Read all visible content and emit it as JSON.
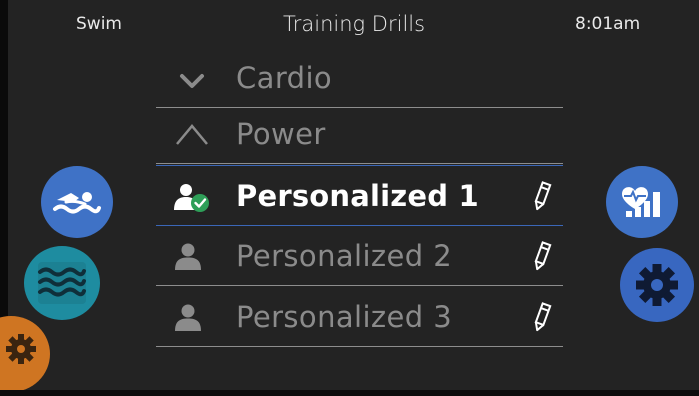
{
  "header": {
    "mode": "Swim",
    "title": "Training Drills",
    "time": "8:01am"
  },
  "list": {
    "items": [
      {
        "label": "Cardio",
        "icon": "chevron-down-icon",
        "editable": false,
        "selected": false
      },
      {
        "label": "Power",
        "icon": "power-chevron-icon",
        "editable": false,
        "selected": false
      },
      {
        "label": "Personalized 1",
        "icon": "user-check-icon",
        "editable": true,
        "selected": true
      },
      {
        "label": "Personalized 2",
        "icon": "user-icon",
        "editable": true,
        "selected": false
      },
      {
        "label": "Personalized 3",
        "icon": "user-icon",
        "editable": true,
        "selected": false
      }
    ]
  },
  "side_buttons": {
    "left": [
      "swim-icon",
      "waves-icon",
      "gear-icon"
    ],
    "right": [
      "heart-chart-icon",
      "gear-icon"
    ]
  },
  "colors": {
    "background": "#232323",
    "selected_text": "#ffffff",
    "unselected_text": "#8b8b8b",
    "selection_line": "#3b67b8",
    "blue_button": "#3f72c6",
    "teal_button": "#1e8ca0",
    "orange_button": "#cf7522",
    "check_badge": "#2e9f58"
  }
}
